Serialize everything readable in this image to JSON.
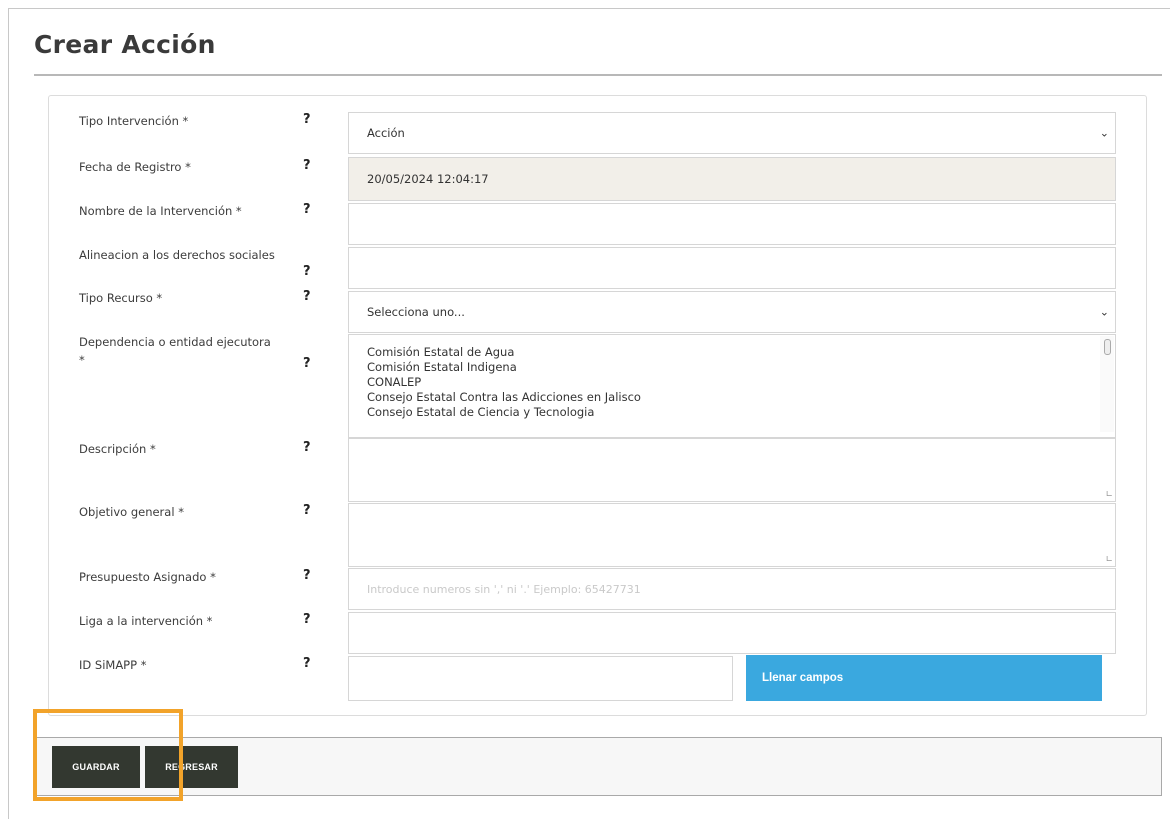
{
  "page_title": "Crear Acción",
  "fields": [
    {
      "label": "Tipo Intervención *",
      "help": "?",
      "value": "Acción"
    },
    {
      "label": "Fecha de Registro *",
      "help": "?",
      "value": "20/05/2024 12:04:17"
    },
    {
      "label": "Nombre de la Intervención *",
      "help": "?",
      "value": ""
    },
    {
      "label": "Alineacion a los derechos sociales",
      "help": "?",
      "value": ""
    },
    {
      "label": "Tipo Recurso *",
      "help": "?",
      "value": "Selecciona uno..."
    },
    {
      "label": "Dependencia o entidad ejecutora *",
      "help": "?",
      "options": [
        "Comisión Estatal de Agua",
        "Comisión Estatal Indigena",
        "CONALEP",
        "Consejo Estatal Contra las Adicciones en Jalisco",
        "Consejo Estatal de Ciencia y Tecnologia"
      ]
    },
    {
      "label": "Descripción *",
      "help": "?",
      "value": ""
    },
    {
      "label": "Objetivo general *",
      "help": "?",
      "value": ""
    },
    {
      "label": "Presupuesto Asignado *",
      "help": "?",
      "placeholder": "Introduce numeros sin ',' ni '.' Ejemplo: 65427731"
    },
    {
      "label": "Liga a la intervención *",
      "help": "?",
      "value": ""
    },
    {
      "label": "ID SiMAPP *",
      "help": "?",
      "value": ""
    }
  ],
  "fill_button": "Llenar campos",
  "footer": {
    "save_label": "GUARDAR",
    "back_label": "REGRESAR"
  },
  "icons": {
    "select_chevron": "chevron-down-icon",
    "resize": "resize-grip-icon"
  },
  "colors": {
    "fill_button": "#3aa8df",
    "dark_button": "#333830",
    "highlight": "#f2a32a",
    "readonly_bg": "#f2efe9"
  }
}
